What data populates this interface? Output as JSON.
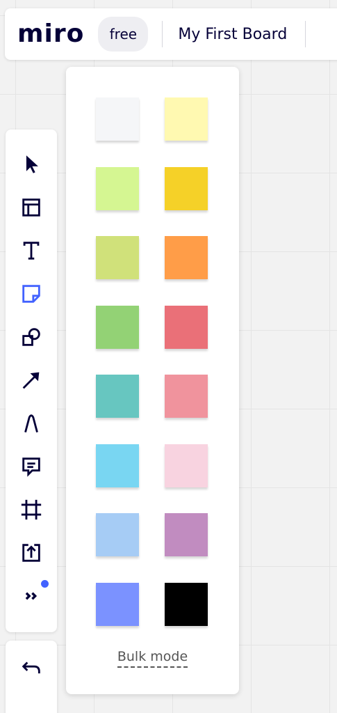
{
  "header": {
    "logo": "miro",
    "plan_badge": "free",
    "board_title": "My First Board"
  },
  "toolbar": {
    "items": [
      {
        "name": "select",
        "icon": "cursor-icon"
      },
      {
        "name": "templates",
        "icon": "templates-icon"
      },
      {
        "name": "text",
        "icon": "text-icon"
      },
      {
        "name": "sticky-note",
        "icon": "sticky-note-icon",
        "active": true
      },
      {
        "name": "shapes",
        "icon": "shapes-icon"
      },
      {
        "name": "connection-line",
        "icon": "arrow-icon"
      },
      {
        "name": "pen",
        "icon": "pen-icon"
      },
      {
        "name": "comment",
        "icon": "comment-icon"
      },
      {
        "name": "frame",
        "icon": "frame-icon"
      },
      {
        "name": "upload",
        "icon": "upload-icon"
      },
      {
        "name": "more-apps",
        "icon": "double-chevron-right-icon"
      }
    ],
    "secondary": [
      {
        "name": "undo",
        "icon": "undo-icon"
      }
    ]
  },
  "colors": {
    "icon": "#050038",
    "active_icon": "#4262ff",
    "notify_dot": "#4262ff"
  },
  "sticky_panel": {
    "colors": [
      "#f5f6f8",
      "#fff9b1",
      "#d5f692",
      "#f5d128",
      "#d0e17a",
      "#ff9d48",
      "#93d275",
      "#ea7078",
      "#67c6c0",
      "#f0939d",
      "#79d6f2",
      "#f8d3e0",
      "#a6ccf5",
      "#c18cc0",
      "#7b92ff",
      "#000000"
    ],
    "bulk_mode_label": "Bulk mode"
  }
}
